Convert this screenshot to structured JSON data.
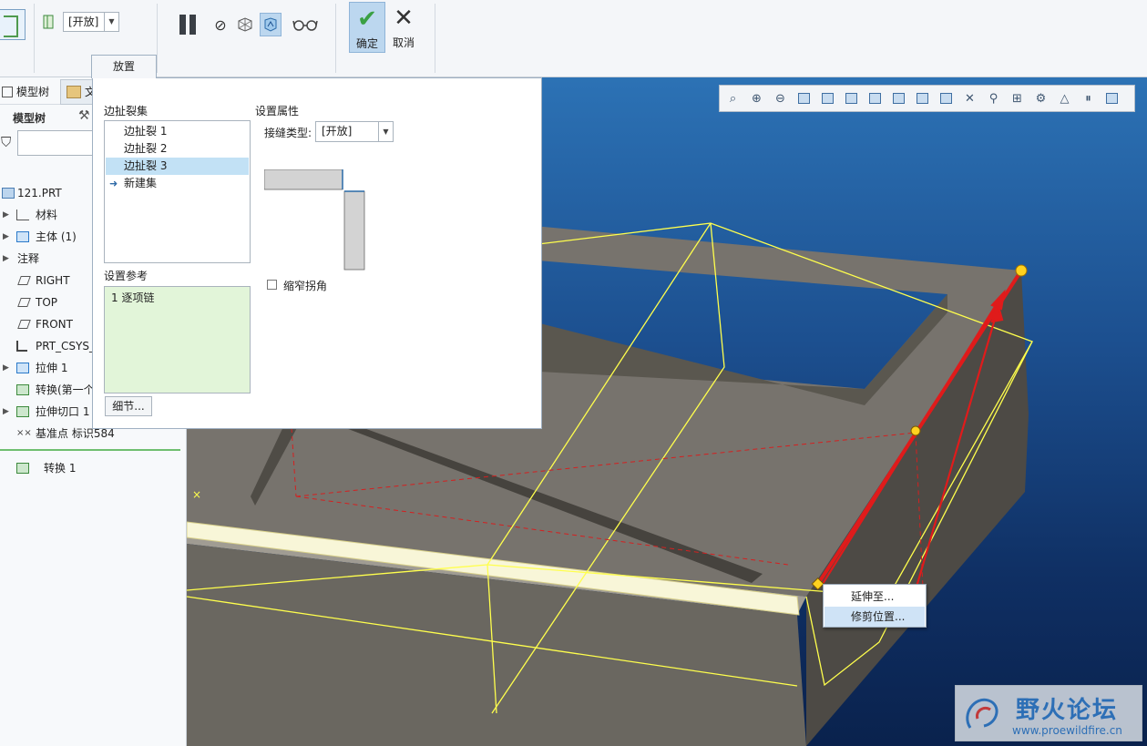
{
  "ribbon": {
    "joint_type_value": "[开放]",
    "placement_tab": "放置",
    "confirm_label": "确定",
    "cancel_label": "取消",
    "confirm_glyph": "✔",
    "cancel_glyph": "✕"
  },
  "left_panel": {
    "tab_model_tree": "模型树",
    "tab_files": "文",
    "header": "模型树",
    "tree_items": [
      {
        "label": "121.PRT",
        "icon": "part-icon"
      },
      {
        "label": "材料",
        "icon": "material-icon"
      },
      {
        "label": "主体 (1)",
        "icon": "body-icon"
      },
      {
        "label": "注释",
        "icon": "annotation-icon"
      },
      {
        "label": "RIGHT",
        "icon": "datum-plane-icon"
      },
      {
        "label": "TOP",
        "icon": "datum-plane-icon"
      },
      {
        "label": "FRONT",
        "icon": "datum-plane-icon"
      },
      {
        "label": "PRT_CSYS_",
        "icon": "csys-icon"
      },
      {
        "label": "拉伸 1",
        "icon": "extrude-icon"
      },
      {
        "label": "转换(第一个",
        "icon": "conversion-icon"
      },
      {
        "label": "拉伸切口 1",
        "icon": "extrude-cut-icon"
      },
      {
        "label": "基准点 标识584",
        "icon": "datum-point-icon"
      }
    ],
    "insert_item": "转换 1"
  },
  "placement_panel": {
    "rip_sets_title": "边扯裂集",
    "rip_sets": [
      "边扯裂 1",
      "边扯裂 2",
      "边扯裂 3"
    ],
    "new_set": "新建集",
    "references_title": "设置参考",
    "reference_item": "1 逐项链",
    "details_button": "细节...",
    "properties_title": "设置属性",
    "joint_type_label": "接缝类型:",
    "joint_type_value": "[开放]",
    "narrow_corner_label": "缩窄拐角"
  },
  "context_menu": {
    "extend_to": "延伸至...",
    "trim_position": "修剪位置..."
  },
  "watermark": {
    "title": "野火论坛",
    "url": "www.proewildfire.cn"
  },
  "colors": {
    "selection_blue": "#c2e1f5",
    "reference_green": "#e2f5d9",
    "highlight_red": "#e01b1b",
    "edge_yellow": "#ffff4d",
    "model_gray": "#706d68"
  }
}
